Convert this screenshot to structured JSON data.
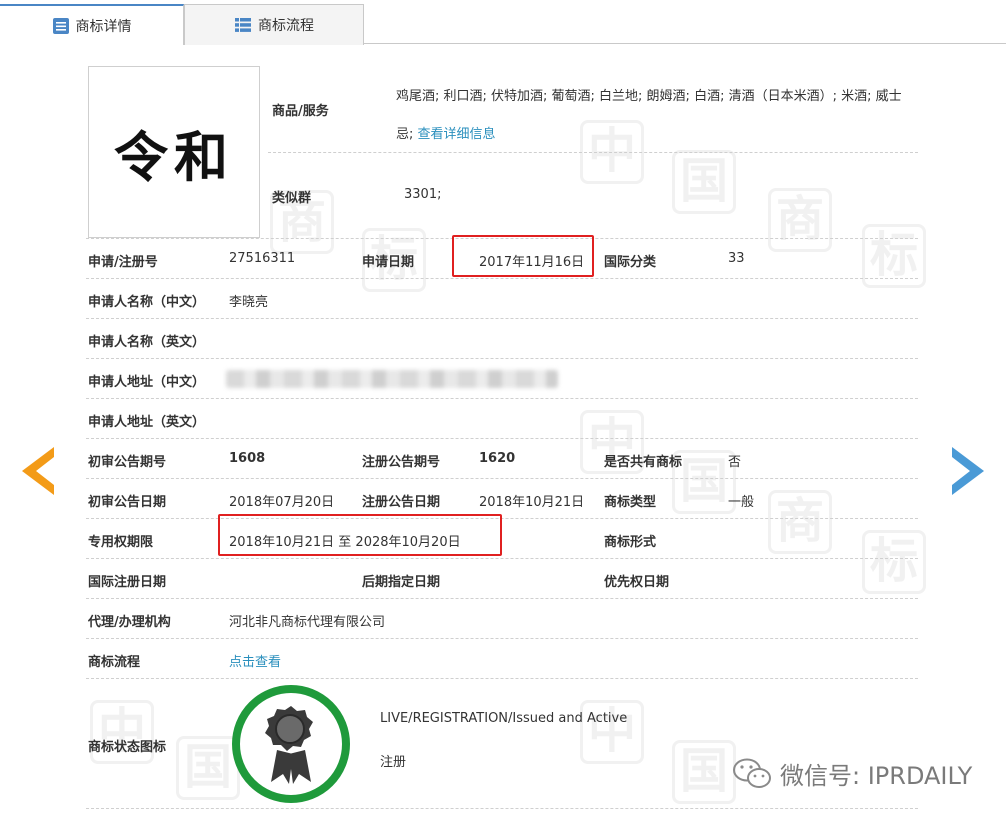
{
  "tabs": [
    {
      "label": "商标详情",
      "icon": "document-list-icon",
      "active": true
    },
    {
      "label": "商标流程",
      "icon": "grid-list-icon",
      "active": false
    }
  ],
  "logo": {
    "text": "令和"
  },
  "goods_services": {
    "label": "商品/服务",
    "items": "鸡尾酒; 利口酒; 伏特加酒; 葡萄酒; 白兰地; 朗姆酒; 白酒; 清酒（日本米酒）; 米酒; 威士忌;",
    "link": "查看详细信息"
  },
  "similar_group": {
    "label": "类似群",
    "value": "3301;"
  },
  "fields": {
    "reg_no_label": "申请/注册号",
    "reg_no": "27516311",
    "app_date_label": "申请日期",
    "app_date": "2017年11月16日",
    "intl_class_label": "国际分类",
    "intl_class": "33",
    "applicant_cn_label": "申请人名称（中文）",
    "applicant_cn": "李晓亮",
    "applicant_en_label": "申请人名称（英文）",
    "address_cn_label": "申请人地址（中文）",
    "address_en_label": "申请人地址（英文）",
    "prelim_issue_label": "初审公告期号",
    "prelim_issue": "1608",
    "reg_issue_label": "注册公告期号",
    "reg_issue": "1620",
    "shared_label": "是否共有商标",
    "shared": "否",
    "prelim_date_label": "初审公告日期",
    "prelim_date": "2018年07月20日",
    "reg_date_label": "注册公告日期",
    "reg_date": "2018年10月21日",
    "mark_type_label": "商标类型",
    "mark_type": "一般",
    "exclusive_label": "专用权期限",
    "exclusive": "2018年10月21日 至 2028年10月20日",
    "mark_form_label": "商标形式",
    "intl_reg_date_label": "国际注册日期",
    "later_desig_label": "后期指定日期",
    "priority_date_label": "优先权日期",
    "agent_label": "代理/办理机构",
    "agent": "河北非凡商标代理有限公司",
    "process_label": "商标流程",
    "process_link": "点击查看",
    "status_label": "商标状态图标",
    "status_en": "LIVE/REGISTRATION/Issued and Active",
    "status_cn": "注册"
  },
  "watermark_text": {
    "a": "中",
    "b": "国",
    "c": "商",
    "d": "标"
  },
  "wechat": {
    "text": "微信号: IPRDAILY",
    "icon": "wechat-icon"
  },
  "colors": {
    "accent": "#4a86c5",
    "link": "#2a8fbd",
    "highlight": "#e02020",
    "arrow_left": "#f39b18",
    "arrow_right": "#4a9ad6",
    "badge_ring": "#1f9a3b"
  }
}
